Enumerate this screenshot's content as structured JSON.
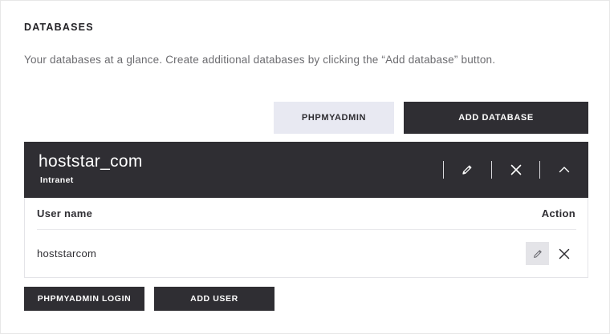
{
  "section": {
    "title": "DATABASES",
    "description": "Your databases at a glance. Create additional databases by clicking the “Add database” button."
  },
  "toolbar": {
    "phpmyadmin_label": "PHPMYADMIN",
    "add_database_label": "ADD DATABASE"
  },
  "database": {
    "name": "hoststar_com",
    "subtitle": "Intranet",
    "header_icons": [
      "pencil-icon",
      "close-icon",
      "chevron-up-icon"
    ],
    "columns": [
      "User name",
      "Action"
    ],
    "users": [
      {
        "username": "hoststarcom",
        "actions": [
          "pencil-icon",
          "close-icon"
        ]
      }
    ]
  },
  "footer": {
    "phpmyadmin_login_label": "PHPMYADMIN LOGIN",
    "add_user_label": "ADD USER"
  },
  "colors": {
    "dark": "#2f2e33",
    "light_button": "#e8e9f2",
    "text": "#2e2d32",
    "muted_text": "#6c6c70"
  }
}
